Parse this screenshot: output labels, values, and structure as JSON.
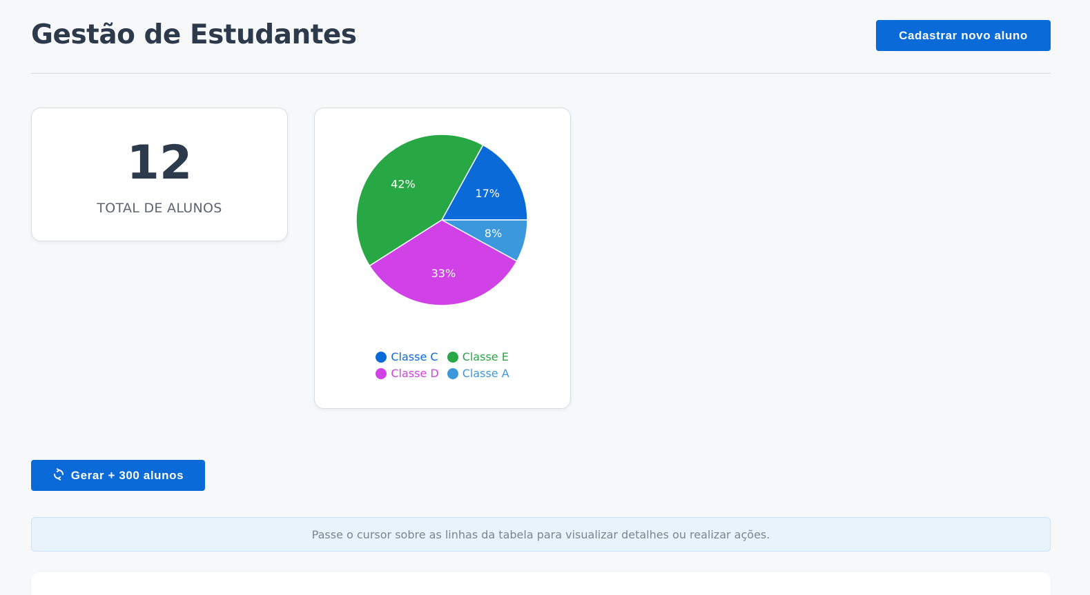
{
  "header": {
    "title": "Gestão de Estudantes",
    "register_button_label": "Cadastrar novo aluno"
  },
  "summary": {
    "total_value": "12",
    "total_label": "TOTAL DE ALUNOS"
  },
  "chart_data": {
    "type": "pie",
    "title": "",
    "slices": [
      {
        "name": "Classe C",
        "value": 17,
        "label": "17%",
        "color": "#0a6ad8"
      },
      {
        "name": "Classe A",
        "value": 8,
        "label": "8%",
        "color": "#3b98dc"
      },
      {
        "name": "Classe D",
        "value": 33,
        "label": "33%",
        "color": "#d041e6"
      },
      {
        "name": "Classe E",
        "value": 42,
        "label": "42%",
        "color": "#28a745"
      }
    ],
    "legend": [
      {
        "name": "Classe C",
        "color": "#0a6ad8"
      },
      {
        "name": "Classe E",
        "color": "#28a745"
      },
      {
        "name": "Classe D",
        "color": "#d041e6"
      },
      {
        "name": "Classe A",
        "color": "#3b98dc"
      }
    ],
    "legend_position": "bottom"
  },
  "actions": {
    "generate_button_label": "Gerar + 300 alunos",
    "generate_icon": "refresh-icon"
  },
  "info": {
    "message": "Passe o cursor sobre as linhas da tabela para visualizar detalhes ou realizar ações."
  }
}
